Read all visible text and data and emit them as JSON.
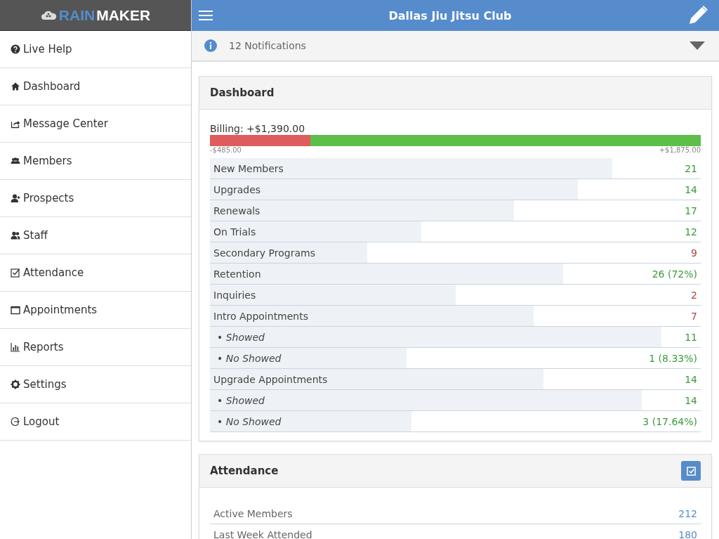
{
  "brand": {
    "part_1": "RAIN",
    "part_2": "MAKER"
  },
  "sidebar": {
    "items": [
      {
        "label": "Live Help"
      },
      {
        "label": "Dashboard"
      },
      {
        "label": "Message Center"
      },
      {
        "label": "Members"
      },
      {
        "label": "Prospects"
      },
      {
        "label": "Staff"
      },
      {
        "label": "Attendance"
      },
      {
        "label": "Appointments"
      },
      {
        "label": "Reports"
      },
      {
        "label": "Settings"
      },
      {
        "label": "Logout"
      }
    ]
  },
  "top_bar": {
    "title": "Dallas Jiu Jitsu Club"
  },
  "notifications": {
    "label": "12 Notifications"
  },
  "dashboard": {
    "title": "Dashboard",
    "billing": {
      "label": "Billing: +$1,390.00",
      "level": 0.205,
      "min_label": "-$485.00",
      "max_label": "+$1,875.00"
    },
    "rows": [
      {
        "kind": "main",
        "label": "New Members",
        "value": "21",
        "level": 0.82,
        "color": "#3c9a3c"
      },
      {
        "kind": "main",
        "label": "Upgrades",
        "value": "14",
        "level": 0.75,
        "color": "#3c9a3c"
      },
      {
        "kind": "main",
        "label": "Renewals",
        "value": "17",
        "level": 0.62,
        "color": "#3c9a3c"
      },
      {
        "kind": "main",
        "label": "On Trials",
        "value": "12",
        "level": 0.43,
        "color": "#3c9a3c"
      },
      {
        "kind": "main",
        "label": "Secondary Programs",
        "value": "9",
        "level": 0.32,
        "color": "#a94442"
      },
      {
        "kind": "main",
        "label": "Retention",
        "value": "26 (72%)",
        "level": 0.72,
        "color": "#3c9a3c"
      },
      {
        "kind": "main",
        "label": "Inquiries",
        "value": "2",
        "level": 0.5,
        "color": "#a94442"
      },
      {
        "kind": "main",
        "label": "Intro Appointments",
        "value": "7",
        "level": 0.66,
        "color": "#a94442"
      },
      {
        "kind": "sub",
        "label": "• Showed",
        "value": "11",
        "level": 0.92,
        "color": "#3c9a3c"
      },
      {
        "kind": "sub",
        "label": "• No Showed",
        "value": "1 (8.33%)",
        "level": 0.4,
        "color": "#3c9a3c"
      },
      {
        "kind": "main",
        "label": "Upgrade Appointments",
        "value": "14",
        "level": 0.68,
        "color": "#3c9a3c"
      },
      {
        "kind": "sub",
        "label": "• Showed",
        "value": "14",
        "level": 0.88,
        "color": "#3c9a3c"
      },
      {
        "kind": "sub",
        "label": "• No Showed",
        "value": "3 (17.64%)",
        "level": 0.41,
        "color": "#3c9a3c"
      }
    ]
  },
  "attendance": {
    "title": "Attendance",
    "rows": [
      {
        "label": "Active Members",
        "value": "212"
      },
      {
        "label": "Last Week Attended",
        "value": "180"
      }
    ]
  }
}
